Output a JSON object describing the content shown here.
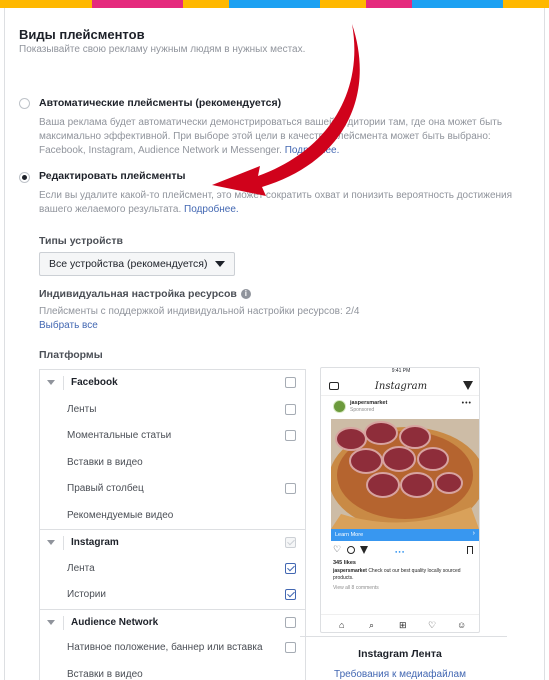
{
  "colors": {
    "top_stripes": [
      "#ffb800",
      "#ffb800",
      "#e52a7d",
      "#e52a7d",
      "#ffb800",
      "#1da1f2",
      "#1da1f2",
      "#ffb800",
      "#e52a7d",
      "#1da1f2",
      "#1da1f2",
      "#ffb800"
    ],
    "accent_link": "#4267b2",
    "annotation_arrow": "#d0021b",
    "checkbox_checked": "#4267b2"
  },
  "header": {
    "title": "Виды плейсментов",
    "subtitle": "Показывайте свою рекламу нужным людям в нужных местах."
  },
  "placement_options": {
    "automatic": {
      "label": "Автоматические плейсменты (рекомендуется)",
      "selected": false,
      "description": "Ваша реклама будет автоматически демонстрироваться вашей аудитории там, где она может быть максимально эффективной. При выборе этой цели в качестве плейсмента может быть выбрано: Facebook, Instagram, Audience Network и Messenger.",
      "link": "Подробнее."
    },
    "edit": {
      "label": "Редактировать плейсменты",
      "selected": true,
      "description": "Если вы удалите какой-то плейсмент, это может сократить охват и понизить вероятность достижения вашего желаемого результата.",
      "link": "Подробнее."
    }
  },
  "device_types": {
    "label": "Типы устройств",
    "selected": "Все устройства (рекомендуется)"
  },
  "asset_customization": {
    "label": "Индивидуальная настройка ресурсов",
    "info_icon": "info-icon",
    "count_text": "Плейсменты с поддержкой индивидуальной настройки ресурсов: 2/4",
    "select_all": "Выбрать все"
  },
  "platforms": {
    "label": "Платформы",
    "groups": [
      {
        "name": "Facebook",
        "checked": false,
        "disabled": false,
        "items": [
          {
            "name": "Ленты",
            "checked": false,
            "has_checkbox": true
          },
          {
            "name": "Моментальные статьи",
            "checked": false,
            "has_checkbox": true
          },
          {
            "name": "Вставки в видео",
            "checked": false,
            "has_checkbox": false
          },
          {
            "name": "Правый столбец",
            "checked": false,
            "has_checkbox": true
          },
          {
            "name": "Рекомендуемые видео",
            "checked": false,
            "has_checkbox": false
          }
        ]
      },
      {
        "name": "Instagram",
        "checked": true,
        "disabled": true,
        "items": [
          {
            "name": "Лента",
            "checked": true,
            "has_checkbox": true
          },
          {
            "name": "Истории",
            "checked": true,
            "has_checkbox": true
          }
        ]
      },
      {
        "name": "Audience Network",
        "checked": false,
        "disabled": false,
        "items": [
          {
            "name": "Нативное положение, баннер или вставка",
            "checked": false,
            "has_checkbox": true
          },
          {
            "name": "Вставки в видео",
            "checked": false,
            "has_checkbox": false
          }
        ]
      }
    ]
  },
  "preview": {
    "status_time": "9:41 PM",
    "app_logo": "Instagram",
    "account": "jaspersmarket",
    "sponsored": "Sponsored",
    "cta": "Learn More",
    "likes": "345 likes",
    "caption_account": "jaspersmarket",
    "caption_text": "Check out our best quality locally sourced products.",
    "comments": "View all 8 comments",
    "title": "Instagram Лента",
    "requirements_link": "Требования к медиафайлам"
  }
}
